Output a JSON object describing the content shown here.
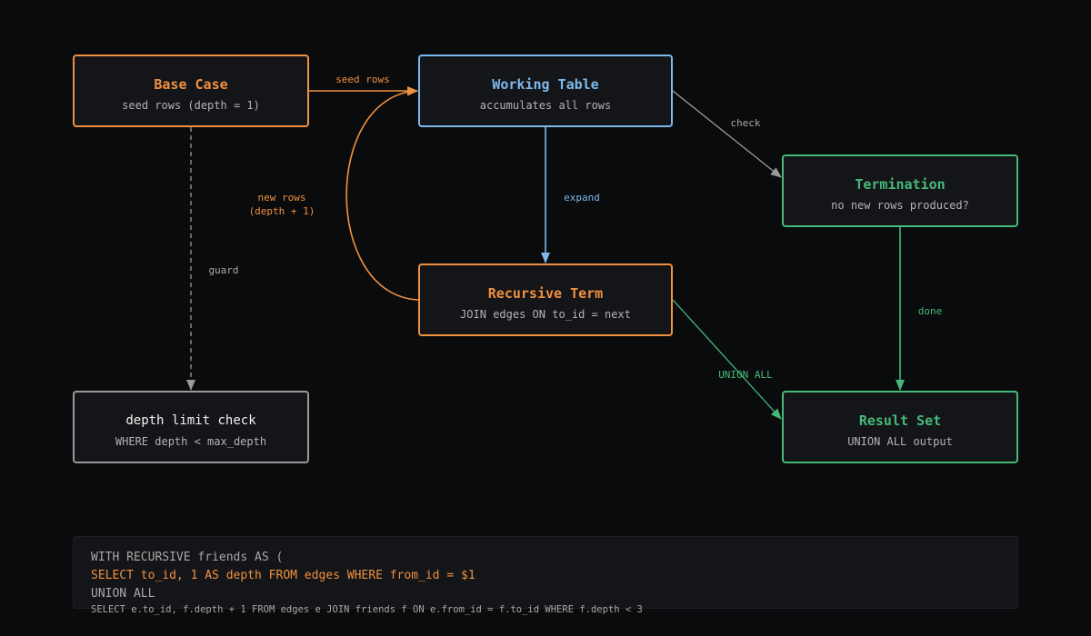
{
  "nodes": {
    "base_case": {
      "title": "Base Case",
      "subtitle": "seed rows (depth = 1)"
    },
    "working_table": {
      "title": "Working Table",
      "subtitle": "accumulates all rows"
    },
    "termination": {
      "title": "Termination",
      "subtitle": "no new rows produced?"
    },
    "recursive_term": {
      "title": "Recursive Term",
      "subtitle": "JOIN edges ON to_id = next"
    },
    "depth_limit": {
      "title": "depth limit check",
      "subtitle": "WHERE depth < max_depth"
    },
    "result_set": {
      "title": "Result Set",
      "subtitle": "UNION ALL output"
    }
  },
  "edges": {
    "seed_rows": "seed rows",
    "check": "check",
    "new_rows_line1": "new rows",
    "new_rows_line2": "(depth + 1)",
    "expand": "expand",
    "guard": "guard",
    "done": "done",
    "union_all": "UNION ALL"
  },
  "code": {
    "line1": "WITH RECURSIVE friends AS (",
    "line2": "SELECT to_id, 1 AS depth FROM edges WHERE from_id = $1",
    "line3": "UNION ALL",
    "line4": "SELECT e.to_id, f.depth + 1 FROM edges e JOIN friends f ON e.from_id = f.to_id WHERE f.depth < 3"
  },
  "colors": {
    "orange": "#f0913f",
    "blue": "#7db9ec",
    "green": "#46b97a",
    "gray": "#9a9a9a",
    "background": "#0a0b0c",
    "node_fill": "#141518"
  }
}
